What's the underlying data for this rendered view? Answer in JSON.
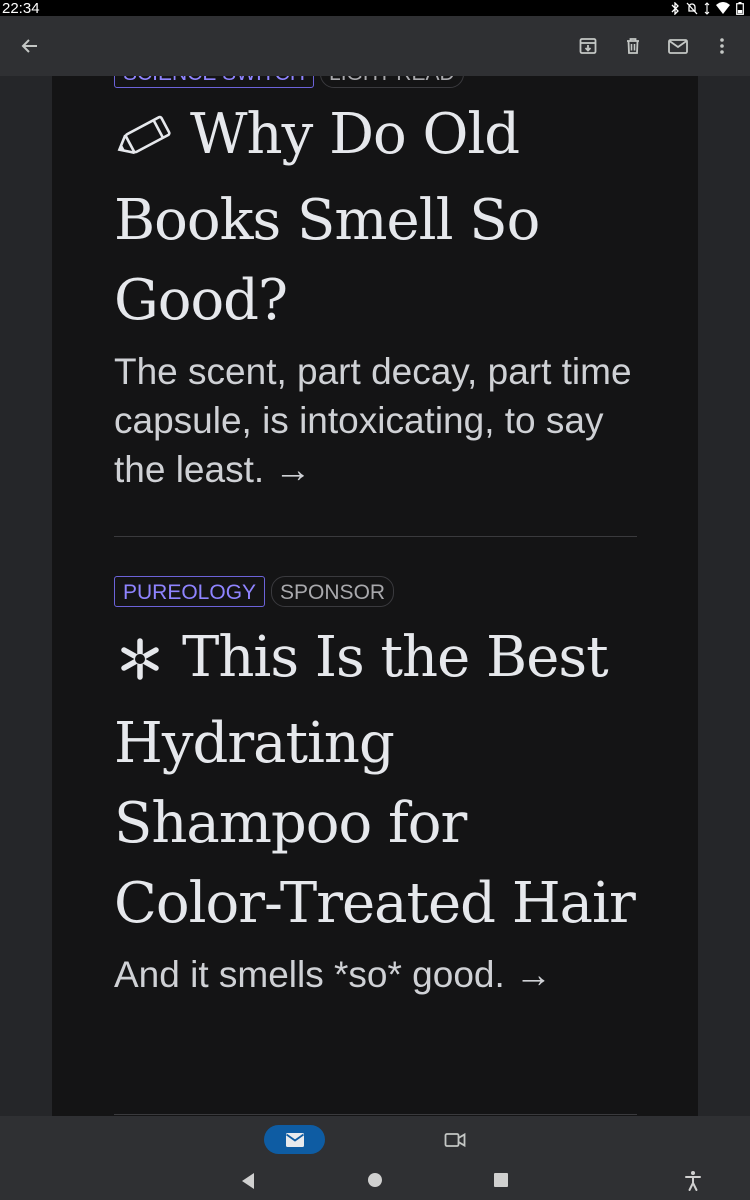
{
  "status_bar": {
    "time": "22:34"
  },
  "articles": [
    {
      "tags": [
        "SCIENCE SWITCH",
        "LIGHT READ"
      ],
      "headline": "Why Do Old Books Smell So Good?",
      "icon": "pencil-icon",
      "subhead": "The scent, part decay, part time capsule, is intoxicating, to say the least. →"
    },
    {
      "tags": [
        "PUREOLOGY",
        "SPONSOR"
      ],
      "headline": "This Is the Best Hydrating Shampoo for Color-Treated Hair",
      "icon": "asterisk-icon",
      "subhead": "And it smells *so* good. →"
    }
  ],
  "colors": {
    "toolbar": "#2f3033",
    "email_bg": "#141415",
    "tag_primary": "#8f84ff",
    "nav_active": "#0e5ca3"
  }
}
